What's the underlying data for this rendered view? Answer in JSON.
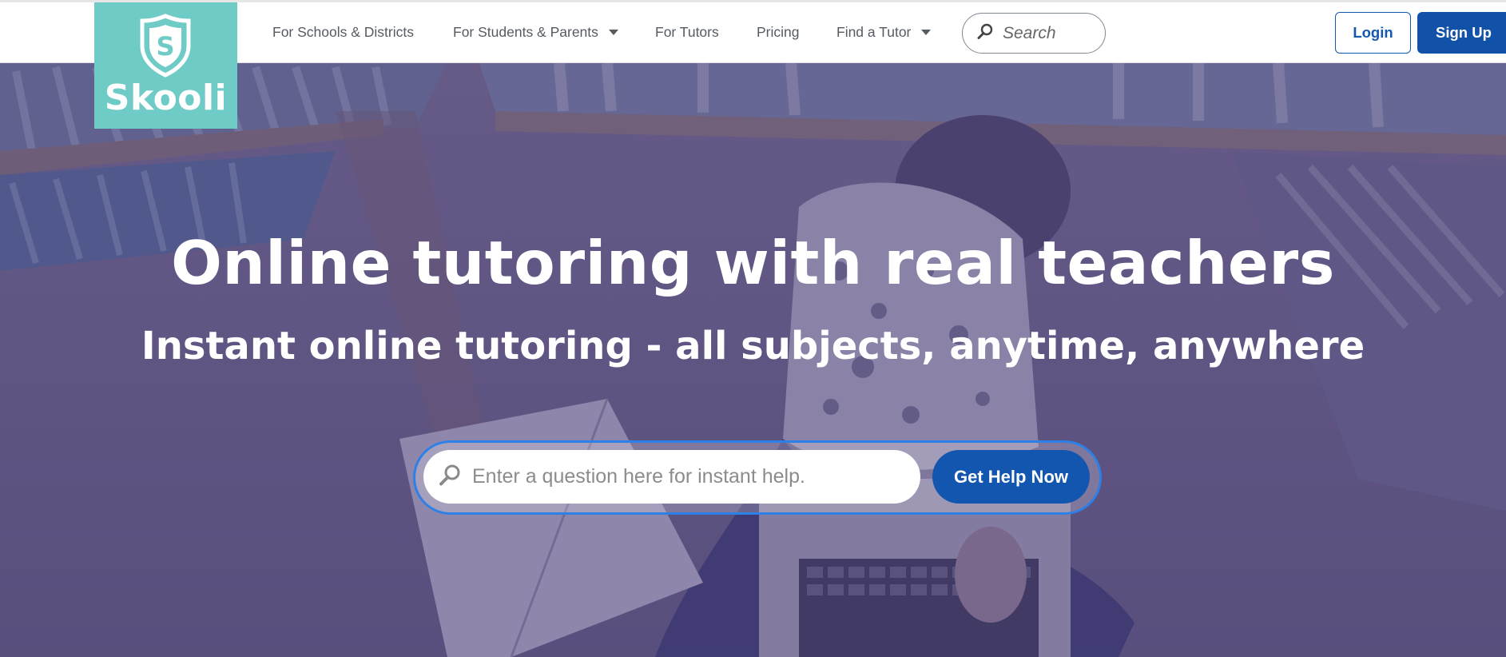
{
  "brand": {
    "name": "Skooli",
    "shield_letter": "S",
    "color": "#6fcbc6"
  },
  "nav": {
    "items": [
      {
        "label": "For Schools & Districts",
        "has_dropdown": false
      },
      {
        "label": "For Students & Parents",
        "has_dropdown": true
      },
      {
        "label": "For Tutors",
        "has_dropdown": false
      },
      {
        "label": "Pricing",
        "has_dropdown": false
      },
      {
        "label": "Find a Tutor",
        "has_dropdown": true
      }
    ],
    "search": {
      "label": "Search",
      "icon": "search-icon"
    },
    "login_label": "Login",
    "signup_label": "Sign Up"
  },
  "hero": {
    "title": "Online tutoring with real teachers",
    "subtitle": "Instant online tutoring - all subjects, anytime, anywhere",
    "question_input": {
      "placeholder": "Enter a question here for instant help.",
      "value": ""
    },
    "cta_label": "Get Help Now"
  },
  "colors": {
    "primary": "#1151a8",
    "overlay": "#483e7a",
    "accent_border": "#2f80e6"
  }
}
